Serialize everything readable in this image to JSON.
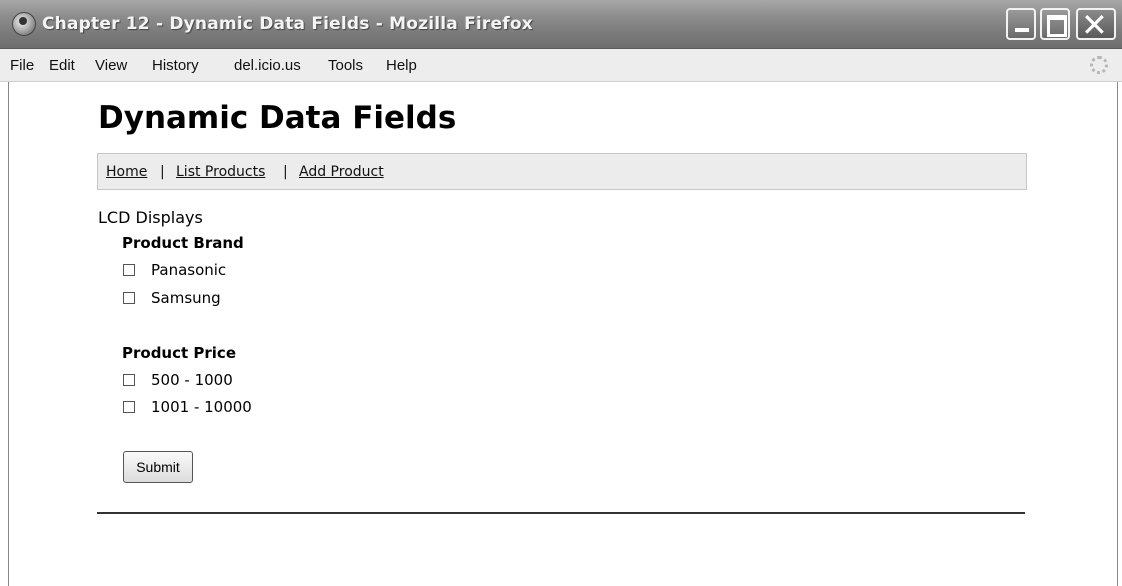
{
  "window": {
    "title": "Chapter 12 - Dynamic Data Fields - Mozilla Firefox",
    "close_glyph": "✕"
  },
  "menu": {
    "items": [
      "File",
      "Edit",
      "View",
      "History",
      "del.icio.us",
      "Tools",
      "Help"
    ]
  },
  "page": {
    "title": "Dynamic Data Fields",
    "nav": {
      "home": "Home",
      "sep": "|",
      "list_products": "List Products",
      "add_product": "Add Product"
    },
    "category": "LCD Displays",
    "brand_group": {
      "label": "Product Brand",
      "options": [
        "Panasonic",
        "Samsung"
      ]
    },
    "price_group": {
      "label": "Product Price",
      "options": [
        "500 - 1000",
        "1001 - 10000"
      ]
    },
    "submit_label": "Submit"
  }
}
